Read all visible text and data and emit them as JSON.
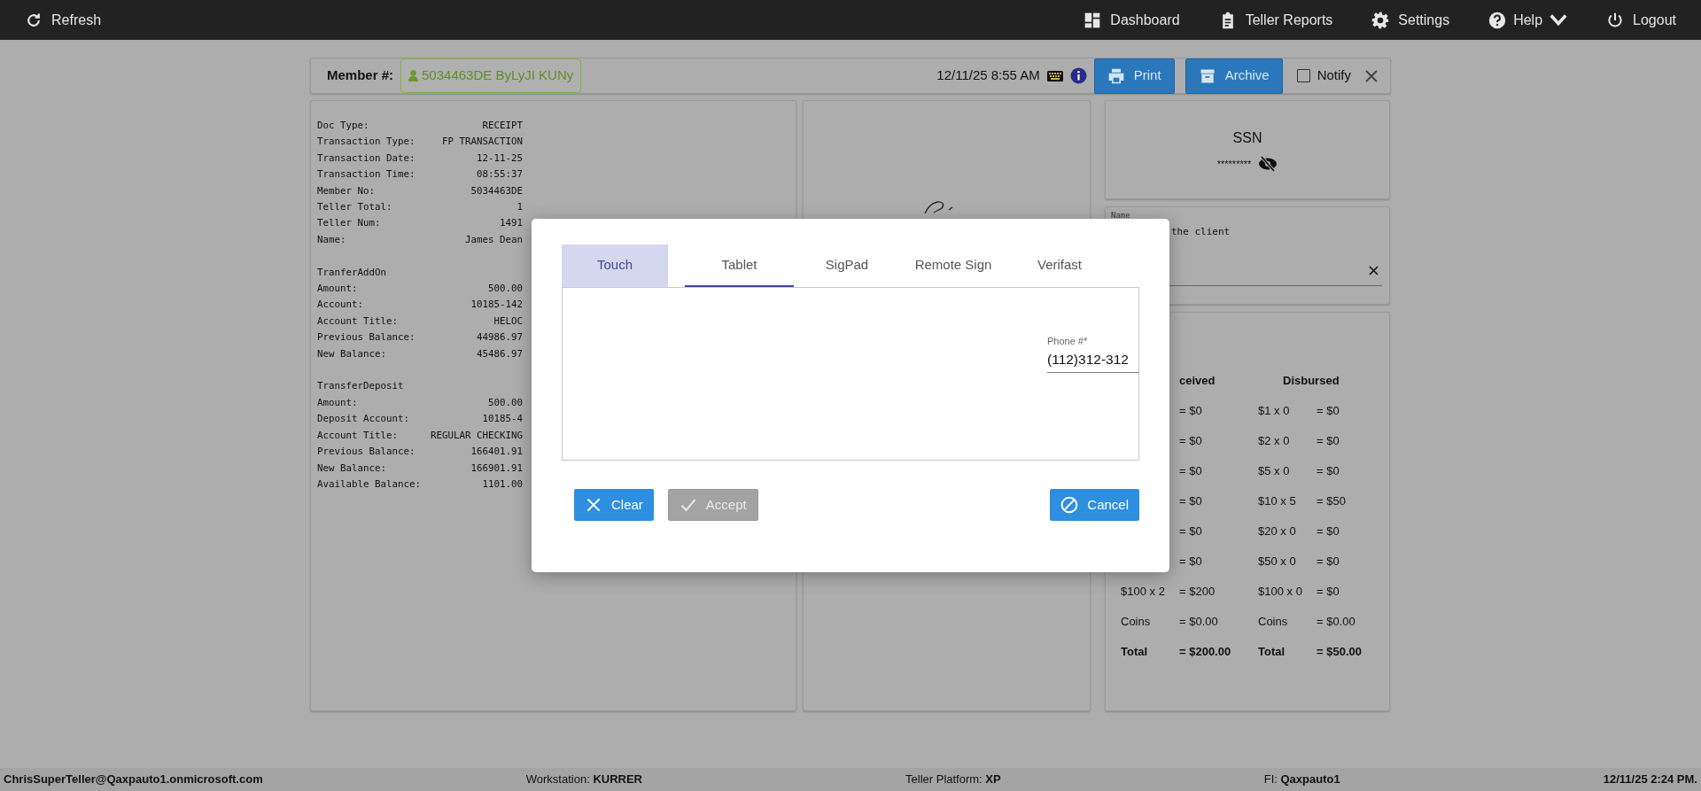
{
  "navbar": {
    "left": [
      {
        "label": "Refresh"
      }
    ],
    "right": [
      {
        "label": "Dashboard",
        "caret": false
      },
      {
        "label": "Teller Reports",
        "caret": false
      },
      {
        "label": "Settings",
        "caret": false
      },
      {
        "label": "Help",
        "caret": true
      },
      {
        "label": "Logout",
        "caret": false
      }
    ]
  },
  "member_bar": {
    "label": "Member #:",
    "member": "5034463DE ByLyJI KUNy",
    "datetime": "12/11/25 8:55 AM",
    "buttons": [
      {
        "label": "Print"
      },
      {
        "label": "Archive"
      }
    ],
    "notify": {
      "label": "Notify",
      "checked": false
    }
  },
  "receipt": {
    "sections": [
      {
        "lines": [
          {
            "label": "Doc Type:",
            "value": "RECEIPT"
          },
          {
            "label": "Transaction Type:",
            "value": "FP TRANSACTION"
          },
          {
            "label": "Transaction Date:",
            "value": "12-11-25"
          },
          {
            "label": "Transaction Time:",
            "value": "08:55:37"
          },
          {
            "label": "Member No:",
            "value": "5034463DE"
          },
          {
            "label": "Teller Total:",
            "value": "1"
          },
          {
            "label": "Teller Num:",
            "value": "1491"
          },
          {
            "label": "Name:",
            "value": "James Dean"
          }
        ]
      },
      {
        "heading": "TranferAddOn",
        "lines": [
          {
            "label": "Amount:",
            "value": "500.00"
          },
          {
            "label": "Account:",
            "value": "10185-142"
          },
          {
            "label": "Account Title:",
            "value": "HELOC"
          },
          {
            "label": "Previous Balance:",
            "value": "44986.97"
          },
          {
            "label": "New Balance:",
            "value": "45486.97"
          }
        ]
      },
      {
        "heading": "TransferDeposit",
        "lines": [
          {
            "label": "Amount:",
            "value": "500.00"
          },
          {
            "label": "Deposit Account:",
            "value": "10185-4"
          },
          {
            "label": "Account Title:",
            "value": "REGULAR CHECKING"
          },
          {
            "label": "Previous Balance:",
            "value": "166401.91"
          },
          {
            "label": "New Balance:",
            "value": "166901.91"
          },
          {
            "label": "Available Balance:",
            "value": "1101.00"
          }
        ]
      }
    ]
  },
  "ssn": {
    "title": "SSN",
    "value": "*********",
    "revealed": false
  },
  "name_card": {
    "label": "Name",
    "text": "the client"
  },
  "cash": {
    "received_heading": "ceived",
    "disbursed_heading": "Disbursed",
    "rows": [
      {
        "kind": "line",
        "received_amount": "= $0",
        "disbursed_denomination": "$1 x 0",
        "disbursed_amount": "= $0"
      },
      {
        "kind": "line",
        "received_amount": "= $0",
        "disbursed_denomination": "$2 x 0",
        "disbursed_amount": "= $0"
      },
      {
        "kind": "line",
        "received_amount": "= $0",
        "disbursed_denomination": "$5 x 0",
        "disbursed_amount": "= $0"
      },
      {
        "kind": "line",
        "received_amount": "= $0",
        "disbursed_denomination": "$10 x 5",
        "disbursed_amount": "= $50"
      },
      {
        "kind": "line",
        "received_amount": "= $0",
        "disbursed_denomination": "$20 x 0",
        "disbursed_amount": "= $0"
      },
      {
        "kind": "line",
        "received_amount": "= $0",
        "disbursed_denomination": "$50 x 0",
        "disbursed_amount": "= $0"
      },
      {
        "kind": "line",
        "received_denomination": "$100 x 2",
        "received_amount": "= $200",
        "disbursed_denomination": "$100 x 0",
        "disbursed_amount": "= $0"
      },
      {
        "kind": "line",
        "received_denomination": "Coins",
        "received_amount": "= $0.00",
        "disbursed_denomination": "Coins",
        "disbursed_amount": "= $0.00"
      },
      {
        "kind": "total",
        "received_denomination": "Total",
        "received_amount": "= $200.00",
        "disbursed_denomination": "Total",
        "disbursed_amount": "= $50.00"
      }
    ]
  },
  "dialog": {
    "tabs": [
      {
        "label": "Touch",
        "selected": true,
        "underlined": false
      },
      {
        "label": "Tablet",
        "selected": false,
        "underlined": true
      },
      {
        "label": "SigPad",
        "selected": false,
        "underlined": false
      },
      {
        "label": "Remote Sign",
        "selected": false,
        "underlined": false
      },
      {
        "label": "Verifast",
        "selected": false,
        "underlined": false
      }
    ],
    "phone": {
      "label": "Phone #*",
      "value": "(112)312-312"
    },
    "buttons": [
      {
        "label": "Clear",
        "disabled": false
      },
      {
        "label": "Accept",
        "disabled": true
      },
      {
        "label": "Cancel",
        "disabled": false
      }
    ]
  },
  "status_bar": [
    "**ChrisSuperTeller@Qaxpauto1.onmicrosoft.com**",
    "Workstation: **KURRER**",
    "Teller Platform: **XP**",
    "FI: **Qaxpauto1**",
    "**12/11/25 2:24 PM.**"
  ]
}
